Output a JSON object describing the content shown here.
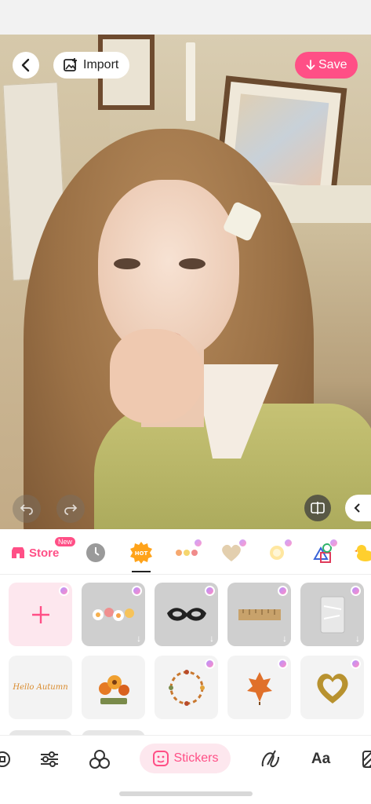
{
  "header": {
    "import_label": "Import",
    "save_label": "Save"
  },
  "categories": {
    "store_label": "Store",
    "new_badge": "New",
    "hot_label": "HOT"
  },
  "stickers": {
    "items": [
      {
        "name": "add-sticker",
        "vip": true
      },
      {
        "name": "flowers-sticker",
        "vip": true,
        "download": true
      },
      {
        "name": "lace-mask-sticker",
        "vip": true,
        "download": true
      },
      {
        "name": "ruler-tape-sticker",
        "vip": true,
        "download": true
      },
      {
        "name": "plastic-bag-sticker",
        "vip": true,
        "download": true
      },
      {
        "name": "hello-autumn-sticker",
        "text": "Hello Autumn"
      },
      {
        "name": "autumn-flowers-sticker"
      },
      {
        "name": "leaf-wreath-sticker",
        "vip": true
      },
      {
        "name": "autumn-leaves-sticker",
        "vip": true
      },
      {
        "name": "gold-heart-frame-sticker",
        "vip": true
      }
    ]
  },
  "toolbar": {
    "stickers_label": "Stickers",
    "text_label": "Aa"
  },
  "colors": {
    "accent": "#ff4f86",
    "accent_soft": "#fde7ee"
  }
}
